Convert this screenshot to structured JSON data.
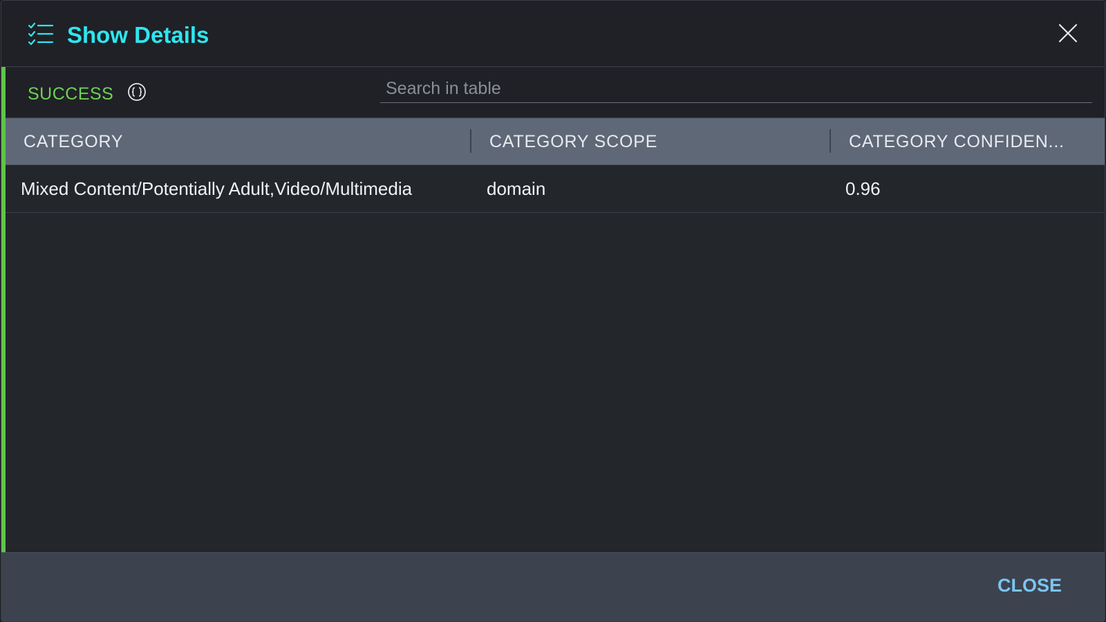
{
  "dialog": {
    "title": "Show Details",
    "title_icon": "checklist-icon",
    "close_icon": "close-icon"
  },
  "toolbar": {
    "status": "SUCCESS",
    "status_color": "#6fd155",
    "json_icon": "json-braces-icon",
    "search_placeholder": "Search in table",
    "search_value": ""
  },
  "table": {
    "columns": [
      "CATEGORY",
      "CATEGORY SCOPE",
      "CATEGORY CONFIDEN..."
    ],
    "rows": [
      [
        "Mixed Content/Potentially Adult,Video/Multimedia",
        "domain",
        "0.96"
      ]
    ]
  },
  "footer": {
    "close_label": "CLOSE"
  },
  "colors": {
    "accent_title": "#2ee6f0",
    "success_bar": "#5fc44a",
    "header_row": "#5f6877",
    "close_button": "#7cc4f2"
  }
}
